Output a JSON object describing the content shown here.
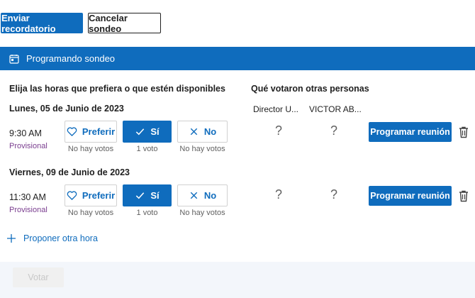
{
  "toolbar": {
    "send_reminder": "Enviar recordatorio",
    "cancel_poll": "Cancelar sondeo"
  },
  "banner": {
    "title": "Programando sondeo",
    "icon": "calendar-icon"
  },
  "headers": {
    "choose": "Elija las horas que prefiera o que estén disponibles",
    "others": "Qué votaron otras personas"
  },
  "voters": [
    "Director U...",
    "VICTOR AB..."
  ],
  "labels": {
    "prefer": "Preferir",
    "yes": "Sí",
    "no": "No",
    "tentative": "Provisional",
    "schedule": "Programar reunión",
    "unknown_vote": "?"
  },
  "slots": [
    {
      "date": "Lunes, 05 de Junio de 2023",
      "time": "9:30 AM",
      "selected": "yes",
      "counts": {
        "prefer": "No hay votos",
        "yes": "1 voto",
        "no": "No hay votos"
      }
    },
    {
      "date": "Viernes, 09 de Junio de 2023",
      "time": "11:30 AM",
      "selected": "yes",
      "counts": {
        "prefer": "No hay votos",
        "yes": "1 voto",
        "no": "No hay votos"
      }
    }
  ],
  "propose": "Proponer otra hora",
  "footer": {
    "vote": "Votar"
  },
  "colors": {
    "accent": "#0f6cbd",
    "tentative": "#7a3d8f",
    "footer_bg": "#f3f6fb"
  }
}
